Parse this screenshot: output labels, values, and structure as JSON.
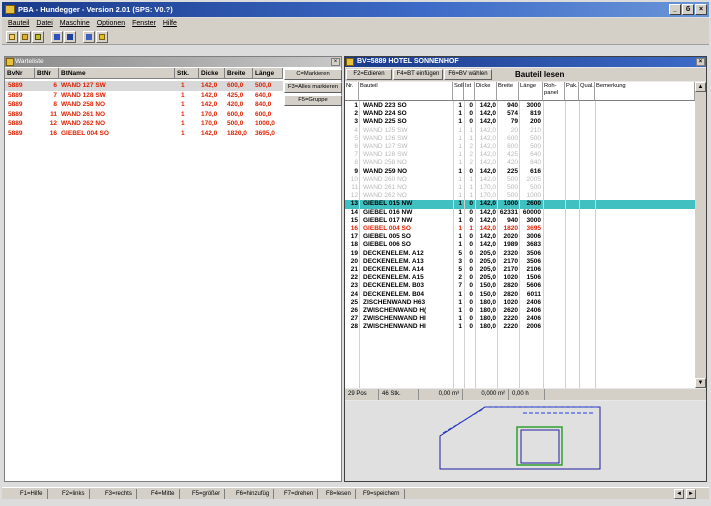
{
  "window": {
    "title": "PBA - Hundegger - Version 2.01 (SPS: V0.?)",
    "controls": [
      "_",
      "б",
      "×"
    ]
  },
  "menu": [
    "Bauteil",
    "Datei",
    "Maschine",
    "Optionen",
    "Fenster",
    "Hilfe"
  ],
  "left_window": {
    "title": "Warteliste",
    "columns": [
      "BvNr",
      "BtNr",
      "BtName",
      "Stk.",
      "Dicke",
      "Breite",
      "Länge"
    ],
    "rows": [
      [
        "5889",
        "6",
        "WAND 127 SW",
        "1",
        "142,0",
        "600,0",
        "500,0"
      ],
      [
        "5889",
        "7",
        "WAND 128 SW",
        "1",
        "142,0",
        "425,0",
        "640,0"
      ],
      [
        "5889",
        "8",
        "WAND 258 NO",
        "1",
        "142,0",
        "420,0",
        "840,0"
      ],
      [
        "5889",
        "11",
        "WAND 261 NO",
        "1",
        "170,0",
        "600,0",
        "600,0"
      ],
      [
        "5889",
        "12",
        "WAND 262 NO",
        "1",
        "170,0",
        "500,0",
        "1000,0"
      ],
      [
        "5889",
        "16",
        "GIEBEL 004 SO",
        "1",
        "142,0",
        "1820,0",
        "3695,0"
      ]
    ],
    "buttons": [
      "C=Markieren",
      "F3=Alles markieren",
      "F5=Gruppe"
    ]
  },
  "right_window": {
    "title": "BV=5889 HOTEL SONNENHOF",
    "toolbar": [
      "F2=Edieren",
      "F4=BT einfügen",
      "F6=BV wählen"
    ],
    "heading": "Bauteil lesen",
    "columns": [
      "Nr.",
      "Bauteil",
      "Soll",
      "Ist",
      "Dicke",
      "Breite",
      "Länge",
      "Roh-panel",
      "Pak.",
      "Qual.",
      "Bemerkung"
    ],
    "rows": [
      {
        "nr": "1",
        "name": "WAND 223 SO",
        "soll": "1",
        "ist": "0",
        "dicke": "142,0",
        "breite": "940",
        "laenge": "3000",
        "style": "normal"
      },
      {
        "nr": "2",
        "name": "WAND 224 SO",
        "soll": "1",
        "ist": "0",
        "dicke": "142,0",
        "breite": "574",
        "laenge": "819",
        "style": "normal"
      },
      {
        "nr": "3",
        "name": "WAND 225 SO",
        "soll": "1",
        "ist": "0",
        "dicke": "142,0",
        "breite": "79",
        "laenge": "200",
        "style": "normal"
      },
      {
        "nr": "4",
        "name": "WAND 125 SW",
        "soll": "1",
        "ist": "1",
        "dicke": "142,0",
        "breite": "20",
        "laenge": "210",
        "style": "dim"
      },
      {
        "nr": "5",
        "name": "WAND 126 SW",
        "soll": "1",
        "ist": "1",
        "dicke": "142,0",
        "breite": "600",
        "laenge": "500",
        "style": "dim"
      },
      {
        "nr": "6",
        "name": "WAND 127 SW",
        "soll": "1",
        "ist": "2",
        "dicke": "142,0",
        "breite": "600",
        "laenge": "500",
        "style": "dim"
      },
      {
        "nr": "7",
        "name": "WAND 128 SW",
        "soll": "1",
        "ist": "2",
        "dicke": "142,0",
        "breite": "425",
        "laenge": "640",
        "style": "dim"
      },
      {
        "nr": "8",
        "name": "WAND 258 NO",
        "soll": "1",
        "ist": "2",
        "dicke": "142,0",
        "breite": "420",
        "laenge": "840",
        "style": "dim"
      },
      {
        "nr": "9",
        "name": "WAND 259 NO",
        "soll": "1",
        "ist": "0",
        "dicke": "142,0",
        "breite": "225",
        "laenge": "616",
        "style": "normal"
      },
      {
        "nr": "10",
        "name": "WAND 260 NO",
        "soll": "1",
        "ist": "1",
        "dicke": "142,0",
        "breite": "500",
        "laenge": "2005",
        "style": "dim"
      },
      {
        "nr": "11",
        "name": "WAND 261 NO",
        "soll": "1",
        "ist": "1",
        "dicke": "170,0",
        "breite": "500",
        "laenge": "500",
        "style": "dim"
      },
      {
        "nr": "12",
        "name": "WAND 262 NO",
        "soll": "1",
        "ist": "1",
        "dicke": "170,0",
        "breite": "500",
        "laenge": "1000",
        "style": "dim"
      },
      {
        "nr": "13",
        "name": "GIEBEL 015 NW",
        "soll": "1",
        "ist": "0",
        "dicke": "142,0",
        "breite": "1000",
        "laenge": "2600",
        "style": "hl"
      },
      {
        "nr": "14",
        "name": "GIEBEL 016 NW",
        "soll": "1",
        "ist": "0",
        "dicke": "142,0",
        "breite": "62331",
        "laenge": "60000",
        "style": "normal"
      },
      {
        "nr": "15",
        "name": "GIEBEL 017 NW",
        "soll": "1",
        "ist": "0",
        "dicke": "142,0",
        "breite": "940",
        "laenge": "3000",
        "style": "normal"
      },
      {
        "nr": "16",
        "name": "GIEBEL 004 SO",
        "soll": "1",
        "ist": "1",
        "dicke": "142,0",
        "breite": "1820",
        "laenge": "3695",
        "style": "red"
      },
      {
        "nr": "17",
        "name": "GIEBEL 005 SO",
        "soll": "1",
        "ist": "0",
        "dicke": "142,0",
        "breite": "2020",
        "laenge": "3006",
        "style": "normal"
      },
      {
        "nr": "18",
        "name": "GIEBEL 006 SO",
        "soll": "1",
        "ist": "0",
        "dicke": "142,0",
        "breite": "1989",
        "laenge": "3683",
        "style": "normal"
      },
      {
        "nr": "19",
        "name": "DECKENELEM. A12",
        "soll": "5",
        "ist": "0",
        "dicke": "205,0",
        "breite": "2320",
        "laenge": "3506",
        "style": "normal"
      },
      {
        "nr": "20",
        "name": "DECKENELEM. A13",
        "soll": "3",
        "ist": "0",
        "dicke": "205,0",
        "breite": "2170",
        "laenge": "3506",
        "style": "normal"
      },
      {
        "nr": "21",
        "name": "DECKENELEM. A14",
        "soll": "5",
        "ist": "0",
        "dicke": "205,0",
        "breite": "2170",
        "laenge": "2106",
        "style": "normal"
      },
      {
        "nr": "22",
        "name": "DECKENELEM. A15",
        "soll": "2",
        "ist": "0",
        "dicke": "205,0",
        "breite": "1020",
        "laenge": "1506",
        "style": "normal"
      },
      {
        "nr": "23",
        "name": "DECKENELEM. B03",
        "soll": "7",
        "ist": "0",
        "dicke": "150,0",
        "breite": "2820",
        "laenge": "5606",
        "style": "normal"
      },
      {
        "nr": "24",
        "name": "DECKENELEM. B04",
        "soll": "1",
        "ist": "0",
        "dicke": "150,0",
        "breite": "2820",
        "laenge": "6011",
        "style": "normal"
      },
      {
        "nr": "25",
        "name": "ZISCHENWAND H63",
        "soll": "1",
        "ist": "0",
        "dicke": "180,0",
        "breite": "1020",
        "laenge": "2406",
        "style": "normal"
      },
      {
        "nr": "26",
        "name": "ZWISCHENWAND H(",
        "soll": "1",
        "ist": "0",
        "dicke": "180,0",
        "breite": "2620",
        "laenge": "2406",
        "style": "normal"
      },
      {
        "nr": "27",
        "name": "ZWISCHENWAND HI",
        "soll": "1",
        "ist": "0",
        "dicke": "180,0",
        "breite": "2220",
        "laenge": "2406",
        "style": "normal"
      },
      {
        "nr": "28",
        "name": "ZWISCHENWAND HI",
        "soll": "1",
        "ist": "0",
        "dicke": "180,0",
        "breite": "2220",
        "laenge": "2006",
        "style": "normal"
      }
    ],
    "status": [
      "29 Pos",
      "46 Stk.",
      "0,00 m³",
      "0,000 m²",
      "0,00 h"
    ]
  },
  "fkeys": [
    "F1=Hilfe",
    "F2=links",
    "F3=rechts",
    "F4=Mitte",
    "F5=größer",
    "F6=hinzufüg",
    "F7=drehen",
    "F8=lesen",
    "F9=speichern"
  ],
  "colors": {
    "accent_red": "#e02000",
    "highlight": "#40c0c0",
    "title_blue": "#1a3a8a"
  }
}
